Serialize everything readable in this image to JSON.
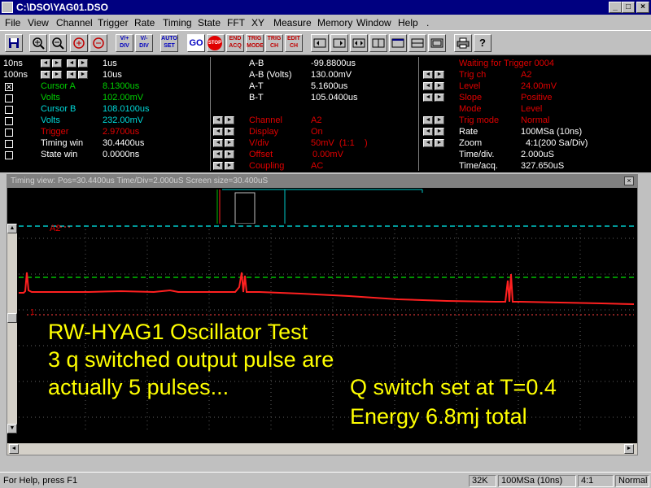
{
  "window": {
    "title": "C:\\DSO\\YAG01.DSO"
  },
  "menu": [
    "File",
    "View",
    "Channel",
    "Trigger",
    "Rate",
    "Timing",
    "State",
    "FFT",
    "XY",
    "Measure",
    "Memory",
    "Window",
    "Help",
    "."
  ],
  "toolbar": {
    "go_label": "GO",
    "stop_label": "STOP",
    "auto_set_label": "AUTO SET",
    "end_acq_label": "END ACQ",
    "trig_mode_label": "TRIG MODE",
    "trig_ch_label": "TRIG CH",
    "edit_ch_label": "EDIT CH",
    "vdiv_up_label": "V/+ DIV",
    "vdiv_down_label": "V/- DIV"
  },
  "left_panel": {
    "timebase_rows": [
      {
        "label": "10ns",
        "value": "1us"
      },
      {
        "label": "100ns",
        "value": "10us"
      }
    ],
    "cursors": [
      {
        "name": "Cursor A",
        "value": "8.1300us",
        "checked": true,
        "color": "green"
      },
      {
        "name": "Volts",
        "value": "102.00mV",
        "checked": false,
        "color": "green"
      },
      {
        "name": "Cursor B",
        "value": "108.0100us",
        "checked": false,
        "color": "cyan"
      },
      {
        "name": "Volts",
        "value": "232.00mV",
        "checked": false,
        "color": "cyan"
      },
      {
        "name": "Trigger",
        "value": "2.9700us",
        "checked": false,
        "color": "red"
      },
      {
        "name": "Timing win",
        "value": "30.4400us",
        "checked": false,
        "color": "white"
      },
      {
        "name": "State win",
        "value": "0.0000ns",
        "checked": false,
        "color": "white"
      }
    ]
  },
  "middle_panel": {
    "measurements": [
      {
        "label": "A-B",
        "value": "-99.8800us"
      },
      {
        "label": "A-B (Volts)",
        "value": "130.00mV"
      },
      {
        "label": "A-T",
        "value": "5.1600us"
      },
      {
        "label": "B-T",
        "value": "105.0400us"
      }
    ],
    "channel": [
      {
        "label": "Channel",
        "value": "A2"
      },
      {
        "label": "Display",
        "value": "On"
      },
      {
        "label": "V/div",
        "value": "50mV  (1:1    )"
      },
      {
        "label": "Offset",
        "value": "0.00mV"
      },
      {
        "label": "Coupling",
        "value": "AC"
      }
    ]
  },
  "right_panel": {
    "status": "Waiting for Trigger 0004",
    "trigger": [
      {
        "label": "Trig ch",
        "value": "A2"
      },
      {
        "label": "Level",
        "value": "24.00mV"
      },
      {
        "label": "Slope",
        "value": "Positive"
      },
      {
        "label": "Mode",
        "value": "Level"
      },
      {
        "label": "Trig mode",
        "value": "Normal"
      }
    ],
    "rate": [
      {
        "label": "Rate",
        "value": "100MSa (10ns)"
      },
      {
        "label": "Zoom",
        "value": "4:1(200 Sa/Div)"
      },
      {
        "label": "Time/div.",
        "value": "2.000uS"
      },
      {
        "label": "Time/acq.",
        "value": "327.650uS"
      }
    ]
  },
  "timing_view": {
    "title": "Timing view: Pos=30.4400us Time/Div=2.000uS Screen size=30.400uS",
    "channel_marker": "A2",
    "ground_marker": "1",
    "annotation_left": [
      "RW-HYAG1 Oscillator Test",
      "3 q switched output pulse are",
      "actually 5 pulses..."
    ],
    "annotation_right": [
      "Q switch set at T=0.4",
      "Energy 6.8mj total"
    ]
  },
  "statusbar": {
    "help": "For Help, press F1",
    "memory": "32K",
    "rate": "100MSa (10ns)",
    "zoom": "4:1",
    "mode": "Normal"
  },
  "colors": {
    "trace": "#ff2020",
    "trigger_level": "#00c8c8",
    "cursor_level": "#00c000",
    "annotation": "#ffff00",
    "title_bar": "#000080"
  }
}
